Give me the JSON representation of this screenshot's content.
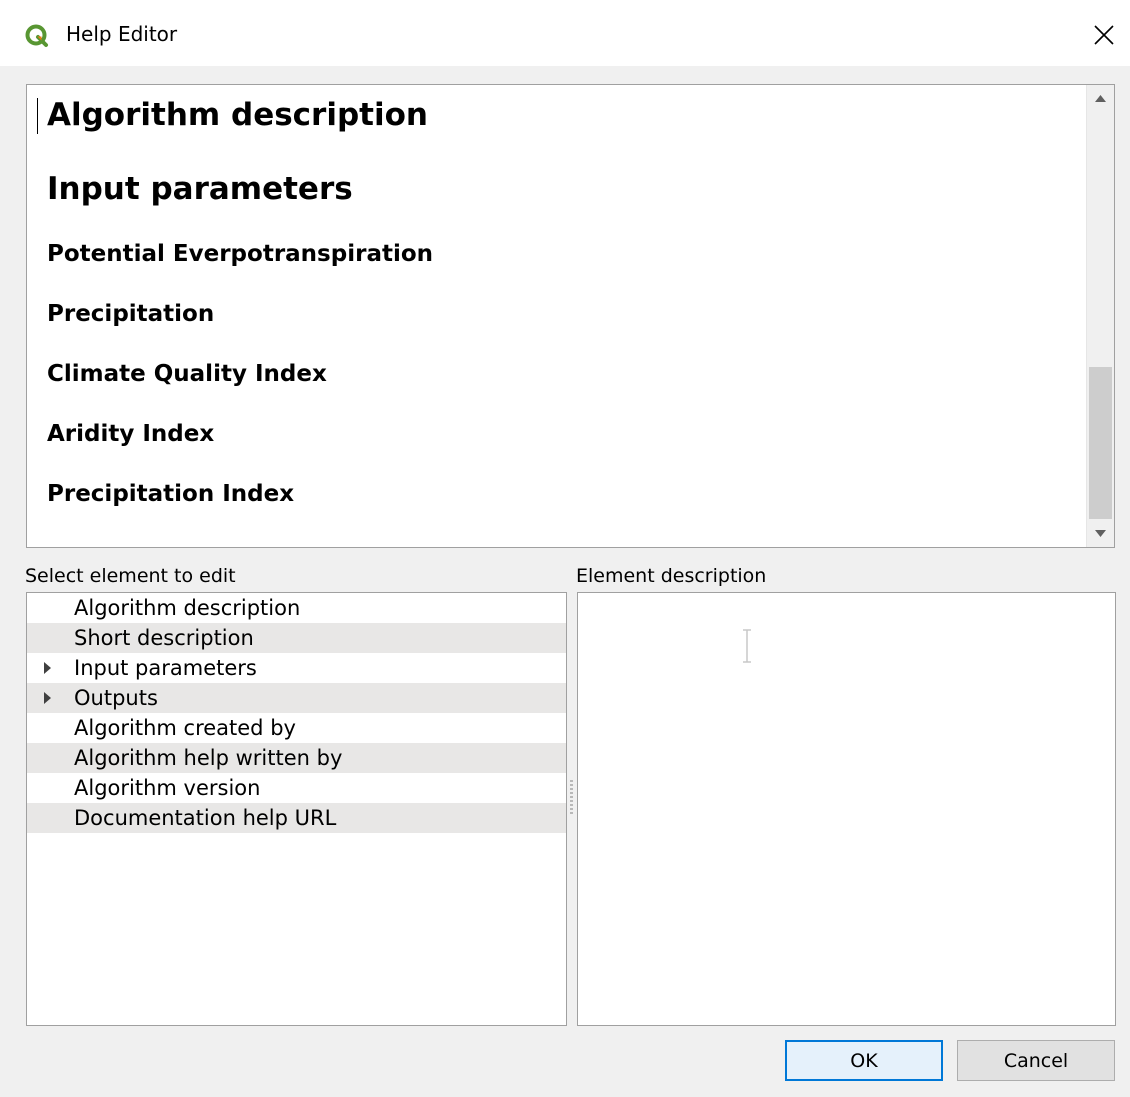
{
  "window": {
    "title": "Help Editor",
    "app_icon": "qgis-logo-icon",
    "close_icon": "close-icon"
  },
  "preview": {
    "headings": [
      {
        "text": "Algorithm description",
        "level": 2
      },
      {
        "text": "Input parameters",
        "level": 2
      },
      {
        "text": "Potential Everpotranspiration",
        "level": 3
      },
      {
        "text": "Precipitation",
        "level": 3
      },
      {
        "text": "Climate Quality Index",
        "level": 3
      },
      {
        "text": "Aridity Index",
        "level": 3
      },
      {
        "text": "Precipitation Index",
        "level": 3
      }
    ]
  },
  "tree": {
    "label": "Select element to edit",
    "items": [
      {
        "label": "Algorithm description",
        "expandable": false
      },
      {
        "label": "Short description",
        "expandable": false
      },
      {
        "label": "Input parameters",
        "expandable": true
      },
      {
        "label": "Outputs",
        "expandable": true
      },
      {
        "label": "Algorithm created by",
        "expandable": false
      },
      {
        "label": "Algorithm help written by",
        "expandable": false
      },
      {
        "label": "Algorithm version",
        "expandable": false
      },
      {
        "label": "Documentation help URL",
        "expandable": false
      }
    ]
  },
  "description": {
    "label": "Element description",
    "value": ""
  },
  "buttons": {
    "ok": "OK",
    "cancel": "Cancel"
  },
  "colors": {
    "accent": "#0078d7",
    "qgis_green": "#589632",
    "qgis_yellow": "#ee7913"
  }
}
